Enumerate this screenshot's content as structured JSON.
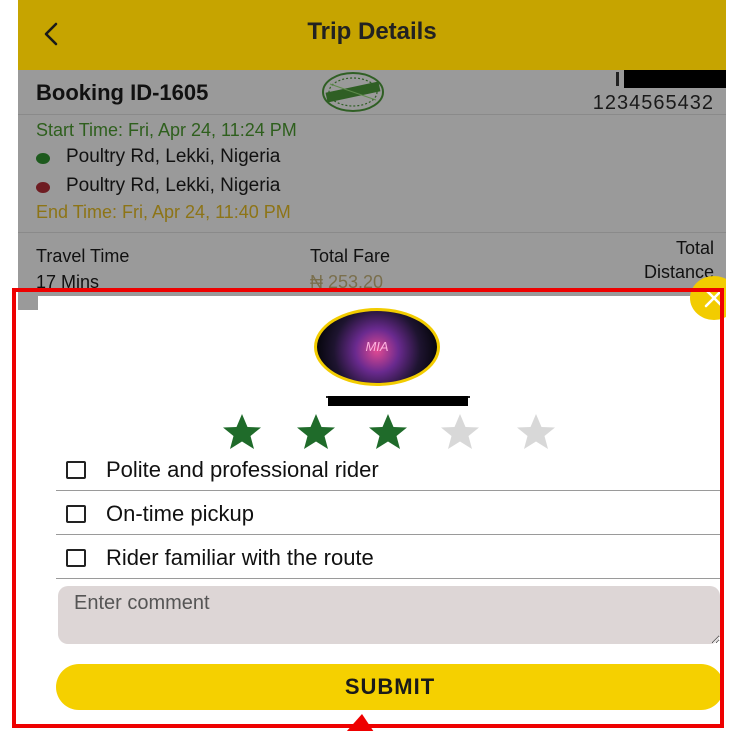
{
  "header": {
    "title": "Trip Details",
    "back_icon": "chevron-left-icon",
    "background_color": "#c6a400"
  },
  "trip": {
    "booking_id": "Booking ID-1605",
    "phone_number": "1234565432",
    "start_time": "Start Time: Fri, Apr 24, 11:24 PM",
    "pickup_location": "Poultry Rd, Lekki, Nigeria",
    "dropoff_location": "Poultry Rd, Lekki, Nigeria",
    "end_time": "End Time: Fri, Apr 24, 11:40 PM",
    "travel_time_label": "Travel Time",
    "travel_time_value": "17 Mins",
    "total_fare_label": "Total Fare",
    "total_fare_value": "₦ 253.20",
    "total_distance_label_line1": "Total",
    "total_distance_label_line2": "Distance",
    "colors": {
      "start_time": "#2e5f1d",
      "end_time": "#8d7416",
      "fare": "#7a6f4d",
      "pickup_dot": "#1d5a1d",
      "dropoff_dot": "#6e1c22"
    }
  },
  "rating": {
    "close_icon": "close-icon",
    "avatar_text": "MIA",
    "stars_total": 5,
    "stars_filled": 3,
    "star_filled_color": "#1f6b2a",
    "star_empty_color": "#d8d8d8",
    "options": [
      {
        "label": "Polite and professional rider",
        "checked": false
      },
      {
        "label": "On-time pickup",
        "checked": false
      },
      {
        "label": "Rider familiar with the route",
        "checked": false
      }
    ],
    "comment_placeholder": "Enter comment",
    "submit_label": "SUBMIT",
    "accent_color": "#f5d000"
  },
  "annotation": {
    "color": "#ee0000"
  }
}
